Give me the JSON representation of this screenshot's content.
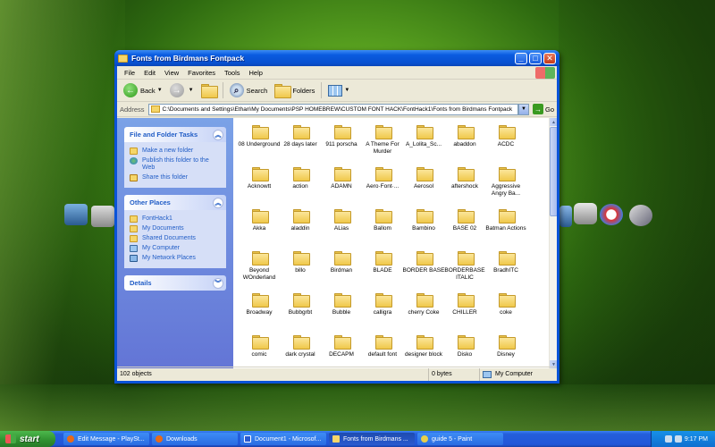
{
  "window": {
    "title": "Fonts from Birdmans Fontpack",
    "min_glyph": "_",
    "max_glyph": "□",
    "close_glyph": "✕"
  },
  "menu": [
    "File",
    "Edit",
    "View",
    "Favorites",
    "Tools",
    "Help"
  ],
  "toolbar": {
    "back_label": "Back",
    "search_label": "Search",
    "folders_label": "Folders"
  },
  "address": {
    "label": "Address",
    "value": "C:\\Documents and Settings\\Ethan\\My Documents\\PSP HOMEBREW\\CUSTOM FONT HACK\\FontHack1\\Fonts from Birdmans Fontpack",
    "go_label": "Go"
  },
  "taskpane": {
    "file_tasks": {
      "title": "File and Folder Tasks",
      "items": [
        {
          "label": "Make a new folder",
          "icon": "new-folder-icon"
        },
        {
          "label": "Publish this folder to the Web",
          "icon": "globe-icon"
        },
        {
          "label": "Share this folder",
          "icon": "share-icon"
        }
      ]
    },
    "other_places": {
      "title": "Other Places",
      "items": [
        {
          "label": "FontHack1",
          "icon": "folder-icon"
        },
        {
          "label": "My Documents",
          "icon": "folder-icon"
        },
        {
          "label": "Shared Documents",
          "icon": "folder-icon"
        },
        {
          "label": "My Computer",
          "icon": "computer-icon"
        },
        {
          "label": "My Network Places",
          "icon": "network-icon"
        }
      ]
    },
    "details": {
      "title": "Details"
    }
  },
  "files": [
    "08 Underground",
    "28 days later",
    "911 porscha",
    "A Theme For Murder",
    "A_Lolita_Sc...",
    "abaddon",
    "ACDC",
    "Acknowtt",
    "action",
    "ADAMN",
    "Aero·Font·...",
    "Aerosol",
    "aftershock",
    "Aggressive Angry Ba...",
    "Akka",
    "aladdin",
    "ALias",
    "Ballom",
    "Bambino",
    "BASE 02",
    "Batman Actions",
    "Beyond WOnderland",
    "billo",
    "Birdman",
    "BLADE",
    "BORDER BASE",
    "BORDERBASE ITALIC",
    "BradhITC",
    "Broadway",
    "Bubbgrbt",
    "Bubble",
    "calligra",
    "cherry Coke",
    "CHILLER",
    "coke",
    "comic",
    "dark crystal",
    "DECAPM",
    "default font",
    "designer block",
    "Disko",
    "Disney"
  ],
  "status": {
    "objects": "102 objects",
    "size": "0 bytes",
    "location": "My Computer"
  },
  "taskbar": {
    "start_label": "start",
    "tasks": [
      {
        "label": "Edit Message - PlaySt...",
        "active": false
      },
      {
        "label": "Downloads",
        "active": false
      },
      {
        "label": "Document1 - Microsof...",
        "active": false
      },
      {
        "label": "Fonts from Birdmans ...",
        "active": true
      },
      {
        "label": "guide 5 - Paint",
        "active": false
      }
    ],
    "clock": "9:17 PM"
  }
}
